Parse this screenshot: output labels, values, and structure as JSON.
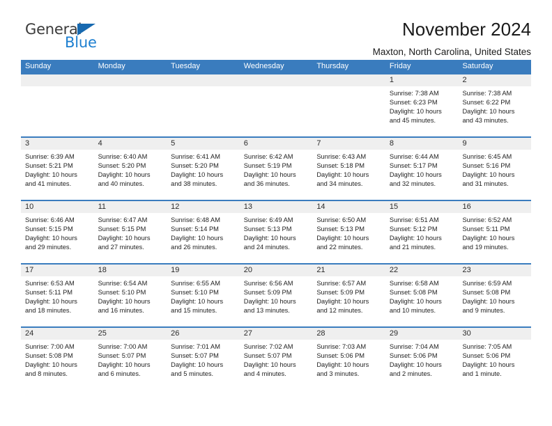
{
  "brand": {
    "name_part1": "General",
    "name_part2": "Blue",
    "triangle_color": "#1769b0",
    "blue_text_color": "#1d7fd0"
  },
  "header": {
    "title": "November 2024",
    "location": "Maxton, North Carolina, United States"
  },
  "theme": {
    "header_blue": "#3a7cbe",
    "day_band_gray": "#efefef",
    "cell_white": "#ffffff"
  },
  "weekdays": [
    "Sunday",
    "Monday",
    "Tuesday",
    "Wednesday",
    "Thursday",
    "Friday",
    "Saturday"
  ],
  "labels": {
    "sunrise_prefix": "Sunrise:",
    "sunset_prefix": "Sunset:",
    "daylight_prefix": "Daylight:"
  },
  "weeks": [
    [
      {
        "day": "",
        "empty": true
      },
      {
        "day": "",
        "empty": true
      },
      {
        "day": "",
        "empty": true
      },
      {
        "day": "",
        "empty": true
      },
      {
        "day": "",
        "empty": true
      },
      {
        "day": "1",
        "sunrise": "Sunrise: 7:38 AM",
        "sunset": "Sunset: 6:23 PM",
        "daylight_1": "Daylight: 10 hours",
        "daylight_2": "and 45 minutes."
      },
      {
        "day": "2",
        "sunrise": "Sunrise: 7:38 AM",
        "sunset": "Sunset: 6:22 PM",
        "daylight_1": "Daylight: 10 hours",
        "daylight_2": "and 43 minutes."
      }
    ],
    [
      {
        "day": "3",
        "sunrise": "Sunrise: 6:39 AM",
        "sunset": "Sunset: 5:21 PM",
        "daylight_1": "Daylight: 10 hours",
        "daylight_2": "and 41 minutes."
      },
      {
        "day": "4",
        "sunrise": "Sunrise: 6:40 AM",
        "sunset": "Sunset: 5:20 PM",
        "daylight_1": "Daylight: 10 hours",
        "daylight_2": "and 40 minutes."
      },
      {
        "day": "5",
        "sunrise": "Sunrise: 6:41 AM",
        "sunset": "Sunset: 5:20 PM",
        "daylight_1": "Daylight: 10 hours",
        "daylight_2": "and 38 minutes."
      },
      {
        "day": "6",
        "sunrise": "Sunrise: 6:42 AM",
        "sunset": "Sunset: 5:19 PM",
        "daylight_1": "Daylight: 10 hours",
        "daylight_2": "and 36 minutes."
      },
      {
        "day": "7",
        "sunrise": "Sunrise: 6:43 AM",
        "sunset": "Sunset: 5:18 PM",
        "daylight_1": "Daylight: 10 hours",
        "daylight_2": "and 34 minutes."
      },
      {
        "day": "8",
        "sunrise": "Sunrise: 6:44 AM",
        "sunset": "Sunset: 5:17 PM",
        "daylight_1": "Daylight: 10 hours",
        "daylight_2": "and 32 minutes."
      },
      {
        "day": "9",
        "sunrise": "Sunrise: 6:45 AM",
        "sunset": "Sunset: 5:16 PM",
        "daylight_1": "Daylight: 10 hours",
        "daylight_2": "and 31 minutes."
      }
    ],
    [
      {
        "day": "10",
        "sunrise": "Sunrise: 6:46 AM",
        "sunset": "Sunset: 5:15 PM",
        "daylight_1": "Daylight: 10 hours",
        "daylight_2": "and 29 minutes."
      },
      {
        "day": "11",
        "sunrise": "Sunrise: 6:47 AM",
        "sunset": "Sunset: 5:15 PM",
        "daylight_1": "Daylight: 10 hours",
        "daylight_2": "and 27 minutes."
      },
      {
        "day": "12",
        "sunrise": "Sunrise: 6:48 AM",
        "sunset": "Sunset: 5:14 PM",
        "daylight_1": "Daylight: 10 hours",
        "daylight_2": "and 26 minutes."
      },
      {
        "day": "13",
        "sunrise": "Sunrise: 6:49 AM",
        "sunset": "Sunset: 5:13 PM",
        "daylight_1": "Daylight: 10 hours",
        "daylight_2": "and 24 minutes."
      },
      {
        "day": "14",
        "sunrise": "Sunrise: 6:50 AM",
        "sunset": "Sunset: 5:13 PM",
        "daylight_1": "Daylight: 10 hours",
        "daylight_2": "and 22 minutes."
      },
      {
        "day": "15",
        "sunrise": "Sunrise: 6:51 AM",
        "sunset": "Sunset: 5:12 PM",
        "daylight_1": "Daylight: 10 hours",
        "daylight_2": "and 21 minutes."
      },
      {
        "day": "16",
        "sunrise": "Sunrise: 6:52 AM",
        "sunset": "Sunset: 5:11 PM",
        "daylight_1": "Daylight: 10 hours",
        "daylight_2": "and 19 minutes."
      }
    ],
    [
      {
        "day": "17",
        "sunrise": "Sunrise: 6:53 AM",
        "sunset": "Sunset: 5:11 PM",
        "daylight_1": "Daylight: 10 hours",
        "daylight_2": "and 18 minutes."
      },
      {
        "day": "18",
        "sunrise": "Sunrise: 6:54 AM",
        "sunset": "Sunset: 5:10 PM",
        "daylight_1": "Daylight: 10 hours",
        "daylight_2": "and 16 minutes."
      },
      {
        "day": "19",
        "sunrise": "Sunrise: 6:55 AM",
        "sunset": "Sunset: 5:10 PM",
        "daylight_1": "Daylight: 10 hours",
        "daylight_2": "and 15 minutes."
      },
      {
        "day": "20",
        "sunrise": "Sunrise: 6:56 AM",
        "sunset": "Sunset: 5:09 PM",
        "daylight_1": "Daylight: 10 hours",
        "daylight_2": "and 13 minutes."
      },
      {
        "day": "21",
        "sunrise": "Sunrise: 6:57 AM",
        "sunset": "Sunset: 5:09 PM",
        "daylight_1": "Daylight: 10 hours",
        "daylight_2": "and 12 minutes."
      },
      {
        "day": "22",
        "sunrise": "Sunrise: 6:58 AM",
        "sunset": "Sunset: 5:08 PM",
        "daylight_1": "Daylight: 10 hours",
        "daylight_2": "and 10 minutes."
      },
      {
        "day": "23",
        "sunrise": "Sunrise: 6:59 AM",
        "sunset": "Sunset: 5:08 PM",
        "daylight_1": "Daylight: 10 hours",
        "daylight_2": "and 9 minutes."
      }
    ],
    [
      {
        "day": "24",
        "sunrise": "Sunrise: 7:00 AM",
        "sunset": "Sunset: 5:08 PM",
        "daylight_1": "Daylight: 10 hours",
        "daylight_2": "and 8 minutes."
      },
      {
        "day": "25",
        "sunrise": "Sunrise: 7:00 AM",
        "sunset": "Sunset: 5:07 PM",
        "daylight_1": "Daylight: 10 hours",
        "daylight_2": "and 6 minutes."
      },
      {
        "day": "26",
        "sunrise": "Sunrise: 7:01 AM",
        "sunset": "Sunset: 5:07 PM",
        "daylight_1": "Daylight: 10 hours",
        "daylight_2": "and 5 minutes."
      },
      {
        "day": "27",
        "sunrise": "Sunrise: 7:02 AM",
        "sunset": "Sunset: 5:07 PM",
        "daylight_1": "Daylight: 10 hours",
        "daylight_2": "and 4 minutes."
      },
      {
        "day": "28",
        "sunrise": "Sunrise: 7:03 AM",
        "sunset": "Sunset: 5:06 PM",
        "daylight_1": "Daylight: 10 hours",
        "daylight_2": "and 3 minutes."
      },
      {
        "day": "29",
        "sunrise": "Sunrise: 7:04 AM",
        "sunset": "Sunset: 5:06 PM",
        "daylight_1": "Daylight: 10 hours",
        "daylight_2": "and 2 minutes."
      },
      {
        "day": "30",
        "sunrise": "Sunrise: 7:05 AM",
        "sunset": "Sunset: 5:06 PM",
        "daylight_1": "Daylight: 10 hours",
        "daylight_2": "and 1 minute."
      }
    ]
  ]
}
